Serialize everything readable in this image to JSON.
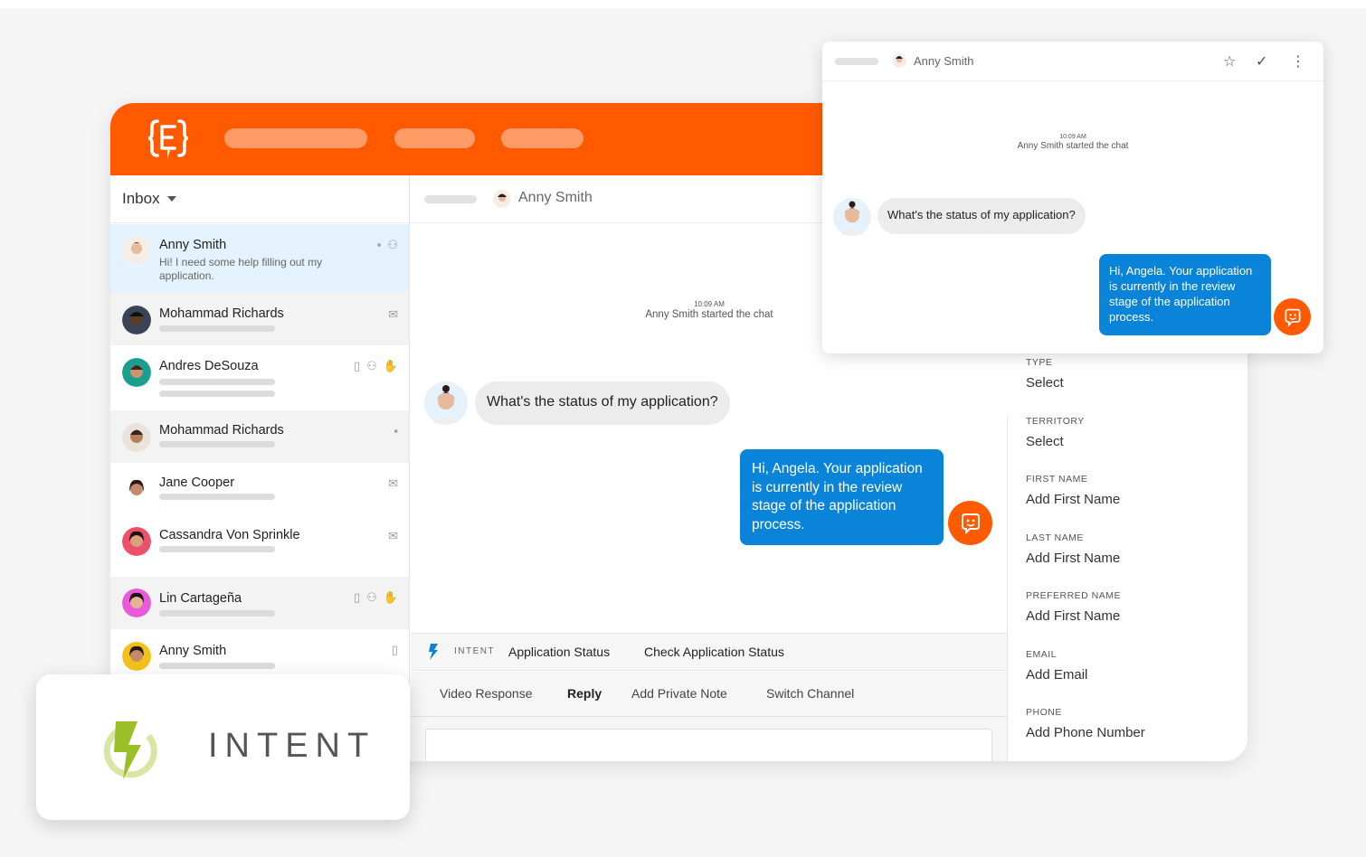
{
  "colors": {
    "brand_orange": "#ff5a00",
    "outgoing_blue": "#0a84d8",
    "intent_green": "#9bbf28"
  },
  "app": {
    "inbox_label": "Inbox",
    "conversations": [
      {
        "name": "Anny Smith",
        "preview": "Hi! I need some help filling out my application.",
        "icons": [
          "chat-icon",
          "person-icon"
        ],
        "avatar_color": "#f1d9c9",
        "selected": true
      },
      {
        "name": "Mohammad Richards",
        "icons": [
          "mail-icon"
        ],
        "avatar_color": "#2c2f3b"
      },
      {
        "name": "Andres DeSouza",
        "icons": [
          "mobile-icon",
          "person-icon",
          "hand-icon"
        ],
        "avatar_color": "#1a9e8f"
      },
      {
        "name": "Mohammad Richards",
        "icons": [
          "chat-icon"
        ],
        "avatar_color": "#e9e3dc"
      },
      {
        "name": "Jane Cooper",
        "icons": [
          "mail-icon"
        ],
        "avatar_color": "#ffffff"
      },
      {
        "name": "Cassandra Von Sprinkle",
        "icons": [
          "mail-icon"
        ],
        "avatar_color": "#ee4f6a"
      },
      {
        "name": "Lin Cartageña",
        "icons": [
          "mobile-icon",
          "person-icon",
          "hand-icon"
        ],
        "avatar_color": "#e85ad8"
      },
      {
        "name": "Anny Smith",
        "icons": [
          "mobile-icon"
        ],
        "avatar_color": "#f2c21a"
      }
    ],
    "chat": {
      "contact_name": "Anny Smith",
      "system_time": "10:09 AM",
      "system_message": "Anny Smith started the chat",
      "incoming_message": "What's the status of my application?",
      "outgoing_message": "Hi, Angela. Your application is currently in the review stage of the application process.",
      "intent_label": "INTENT",
      "intent_value": "Application Status",
      "intent_action": "Check Application Status",
      "tabs": [
        "Video Response",
        "Reply",
        "Add Private Note",
        "Switch Channel"
      ],
      "active_tab": "Reply"
    },
    "details": [
      {
        "label": "TYPE",
        "value": "Select"
      },
      {
        "label": "TERRITORY",
        "value": "Select"
      },
      {
        "label": "FIRST NAME",
        "value": "Add First Name"
      },
      {
        "label": "LAST NAME",
        "value": "Add First Name"
      },
      {
        "label": "PREFERRED NAME",
        "value": "Add First Name"
      },
      {
        "label": "EMAIL",
        "value": "Add Email"
      },
      {
        "label": "PHONE",
        "value": "Add Phone Number"
      }
    ]
  },
  "float_window": {
    "contact_name": "Anny Smith",
    "system_time": "10:09 AM",
    "system_message": "Anny Smith started the chat",
    "incoming_message": "What's the status of my application?",
    "outgoing_message": "Hi, Angela. Your application is currently in the review stage of the application process.",
    "actions": [
      "star-icon",
      "check-icon",
      "more-vertical-icon"
    ]
  },
  "intent_card": {
    "brand_text": "INTENT"
  }
}
